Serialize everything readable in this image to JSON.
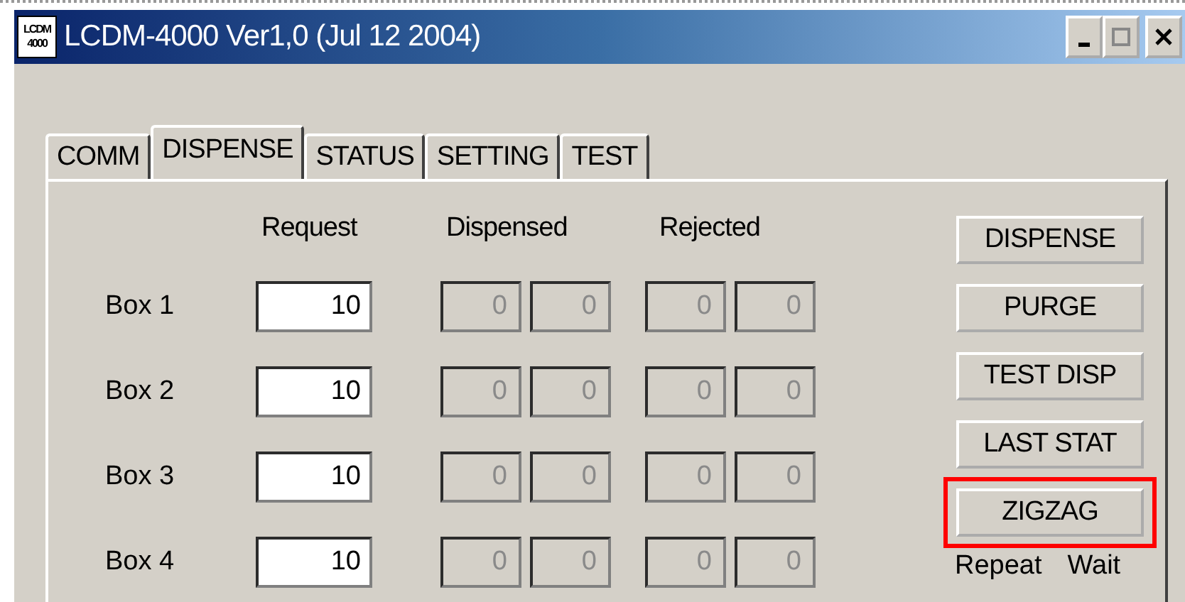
{
  "window": {
    "title": "LCDM-4000 Ver1,0 (Jul 12 2004)",
    "icon_text": [
      "LCDM",
      "4000"
    ],
    "controls": [
      {
        "kind": "minimize"
      },
      {
        "kind": "maximize"
      },
      {
        "kind": "close"
      }
    ]
  },
  "tabs": [
    {
      "label": "COMM",
      "selected": false
    },
    {
      "label": "DISPENSE",
      "selected": true
    },
    {
      "label": "STATUS",
      "selected": false
    },
    {
      "label": "SETTING",
      "selected": false
    },
    {
      "label": "TEST",
      "selected": false
    }
  ],
  "columns": [
    "Request",
    "Dispensed",
    "Rejected"
  ],
  "rows": [
    {
      "label": "Box 1",
      "request": "10",
      "dispensed": [
        {
          "value": "0",
          "disabled": true
        },
        {
          "value": "0",
          "disabled": true
        }
      ],
      "rejected": [
        {
          "value": "0",
          "disabled": true
        },
        {
          "value": "0",
          "disabled": true
        }
      ]
    },
    {
      "label": "Box 2",
      "request": "10",
      "dispensed": [
        {
          "value": "0",
          "disabled": true
        },
        {
          "value": "0",
          "disabled": true
        }
      ],
      "rejected": [
        {
          "value": "0",
          "disabled": true
        },
        {
          "value": "0",
          "disabled": true
        }
      ]
    },
    {
      "label": "Box 3",
      "request": "10",
      "dispensed": [
        {
          "value": "0",
          "disabled": true
        },
        {
          "value": "0",
          "disabled": true
        }
      ],
      "rejected": [
        {
          "value": "0",
          "disabled": true
        },
        {
          "value": "0",
          "disabled": true
        }
      ]
    },
    {
      "label": "Box 4",
      "request": "10",
      "dispensed": [
        {
          "value": "0",
          "disabled": true
        },
        {
          "value": "0",
          "disabled": true
        }
      ],
      "rejected": [
        {
          "value": "0",
          "disabled": true
        },
        {
          "value": "0",
          "disabled": true
        }
      ]
    }
  ],
  "buttons": [
    {
      "label": "DISPENSE",
      "highlighted": false
    },
    {
      "label": "PURGE",
      "highlighted": false
    },
    {
      "label": "TEST DISP",
      "highlighted": false
    },
    {
      "label": "LAST STAT",
      "highlighted": false
    },
    {
      "label": "ZIGZAG",
      "highlighted": true
    }
  ],
  "footer_labels": [
    "Repeat",
    "Wait"
  ]
}
